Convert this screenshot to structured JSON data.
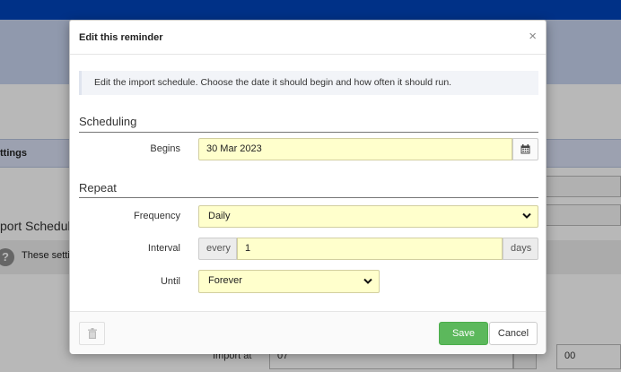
{
  "background": {
    "settings_label": "ttings",
    "section_title": "port Schedule",
    "help_icon_glyph": "?",
    "help_text": "These setti",
    "import_at_label": "Import at",
    "import_at_value": "07",
    "minutes_value": "00"
  },
  "modal": {
    "title": "Edit this reminder",
    "close_glyph": "×",
    "info_text": "Edit the import schedule. Choose the date it should begin and how often it should run.",
    "scheduling": {
      "title": "Scheduling",
      "begins_label": "Begins",
      "begins_value": "30 Mar 2023"
    },
    "repeat": {
      "title": "Repeat",
      "frequency_label": "Frequency",
      "frequency_value": "Daily",
      "interval_label": "Interval",
      "interval_prefix": "every",
      "interval_value": "1",
      "interval_suffix": "days",
      "until_label": "Until",
      "until_value": "Forever"
    },
    "footer": {
      "save_label": "Save",
      "cancel_label": "Cancel"
    }
  },
  "icons": {
    "calendar": "calendar-icon",
    "chevron": "chevron-down-icon",
    "trash": "trash-icon",
    "close": "close-icon",
    "help": "help-icon"
  },
  "colors": {
    "topbar": "#0044bb",
    "input_highlight": "#ffffcc",
    "save_button": "#5cb85c"
  }
}
